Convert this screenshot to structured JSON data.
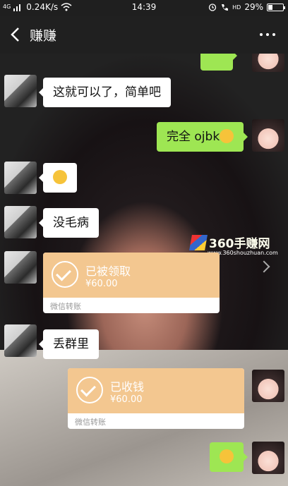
{
  "status_bar": {
    "network_type": "4G",
    "speed": "0.24K/s",
    "time": "14:39",
    "volte": "HD",
    "battery_percent": "29%",
    "battery_level": 0.29,
    "icons": [
      "signal-icon",
      "wifi-icon",
      "alarm-icon",
      "hd-call-icon"
    ]
  },
  "nav": {
    "title": "赚赚",
    "back_icon": "chevron-left-icon",
    "more_icon": "more-dots-icon"
  },
  "messages": [
    {
      "from": "them",
      "type": "text",
      "text": "这就可以了，简单吧"
    },
    {
      "from": "me",
      "type": "text",
      "text": "完全 ojbk",
      "emoji": "laughing-crying-emoji"
    },
    {
      "from": "them",
      "type": "emoji",
      "emoji": "smirk-emoji"
    },
    {
      "from": "them",
      "type": "text",
      "text": "没毛病"
    },
    {
      "from": "them",
      "type": "transfer",
      "status": "已被领取",
      "amount": "¥60.00",
      "footer": "微信转账"
    },
    {
      "from": "them",
      "type": "text",
      "text": "丢群里"
    },
    {
      "from": "me",
      "type": "transfer",
      "status": "已收钱",
      "amount": "¥60.00",
      "footer": "微信转账"
    },
    {
      "from": "me",
      "type": "emoji",
      "emoji": "ok-hand-emoji"
    }
  ],
  "watermark": {
    "brand": "360手赚网",
    "url": "www.360shouzhuan.com"
  },
  "colors": {
    "incoming_bubble": "#ffffff",
    "outgoing_bubble": "#9ee653",
    "transfer_card": "#f3c790",
    "navbar": "#202020"
  }
}
